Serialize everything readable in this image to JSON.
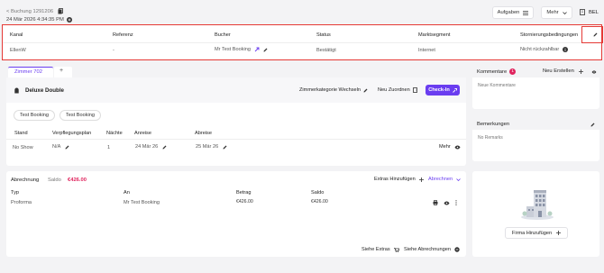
{
  "header": {
    "back_label": "< Buchung 1291206",
    "timestamp": "24 Mär 2026 4:34:35 PM",
    "tasks_label": "Aufgaben",
    "more_label": "Mehr",
    "hotel_code": "BEL"
  },
  "booking_table": {
    "columns": [
      "Kanal",
      "Referenz",
      "Bucher",
      "Status",
      "Marktsegment",
      "Stornierungsbedingungen"
    ],
    "values": [
      "EllenW",
      "-",
      "Mr Test Booking",
      "Bestätigt",
      "Internet",
      "Nicht rückzahlbar"
    ]
  },
  "room_tabs": {
    "active": "Zimmer 702",
    "add": "+"
  },
  "room": {
    "name": "Deluxe Double",
    "change_category": "Zimmerkategorie Wechseln",
    "reassign": "Neu Zuordnen",
    "checkin": "Check-In",
    "guests": [
      "Test Booking",
      "Test Booking"
    ],
    "columns": [
      "Stand",
      "Verpflegungsplan",
      "Nächte",
      "Anreise",
      "Abreise"
    ],
    "values": [
      "No Show",
      "N/A",
      "1",
      "24 Mär 26",
      "25 Mär 26"
    ],
    "more": "Mehr"
  },
  "billing": {
    "title": "Abrechnung",
    "balance_label": "Saldo",
    "balance_value": "€426.00",
    "add_extras": "Extras Hinzufügen",
    "settle": "Abrechnen",
    "columns": [
      "Typ",
      "An",
      "Betrag",
      "Saldo"
    ],
    "row": [
      "Proforma",
      "Mr Test Booking",
      "€426.00",
      "€426.00"
    ],
    "view_extras": "Siehe Extras",
    "view_settlements": "Siehe Abrechnungen"
  },
  "comments": {
    "title": "Kommentare",
    "count": "1",
    "new_label": "Neu Erstellen",
    "placeholder": "Neue Kommentare"
  },
  "remarks": {
    "title": "Bemerkungen",
    "text": "No Remarks"
  },
  "company": {
    "add_label": "Firma Hinzufügen"
  },
  "colors": {
    "accent": "#6a3df0",
    "danger": "#e0245e",
    "highlight_border": "#e53935"
  }
}
